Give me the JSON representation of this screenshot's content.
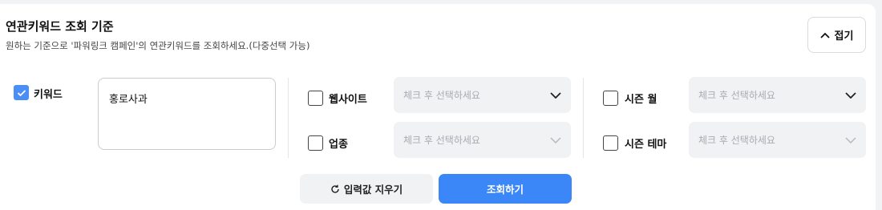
{
  "header": {
    "title": "연관키워드 조회 기준",
    "description": "원하는 기준으로 '파워링크 캠페인'의 연관키워드를 조회하세요.(다중선택 가능)",
    "collapse_label": "접기"
  },
  "keyword": {
    "label": "키워드",
    "checked": true,
    "value": "홍로사과"
  },
  "filters": {
    "website": {
      "label": "웹사이트",
      "placeholder": "체크 후 선택하세요",
      "checked": false
    },
    "industry": {
      "label": "업종",
      "placeholder": "체크 후 선택하세요",
      "checked": false
    },
    "season_month": {
      "label": "시즌 월",
      "placeholder": "체크 후 선택하세요",
      "checked": false
    },
    "season_theme": {
      "label": "시즌 테마",
      "placeholder": "체크 후 선택하세요",
      "checked": false
    }
  },
  "actions": {
    "reset_label": "입력값 지우기",
    "search_label": "조회하기"
  },
  "colors": {
    "accent": "#3b87f7",
    "checkbox_checked": "#4b8ef6",
    "select_bg": "#f1f2f4"
  }
}
